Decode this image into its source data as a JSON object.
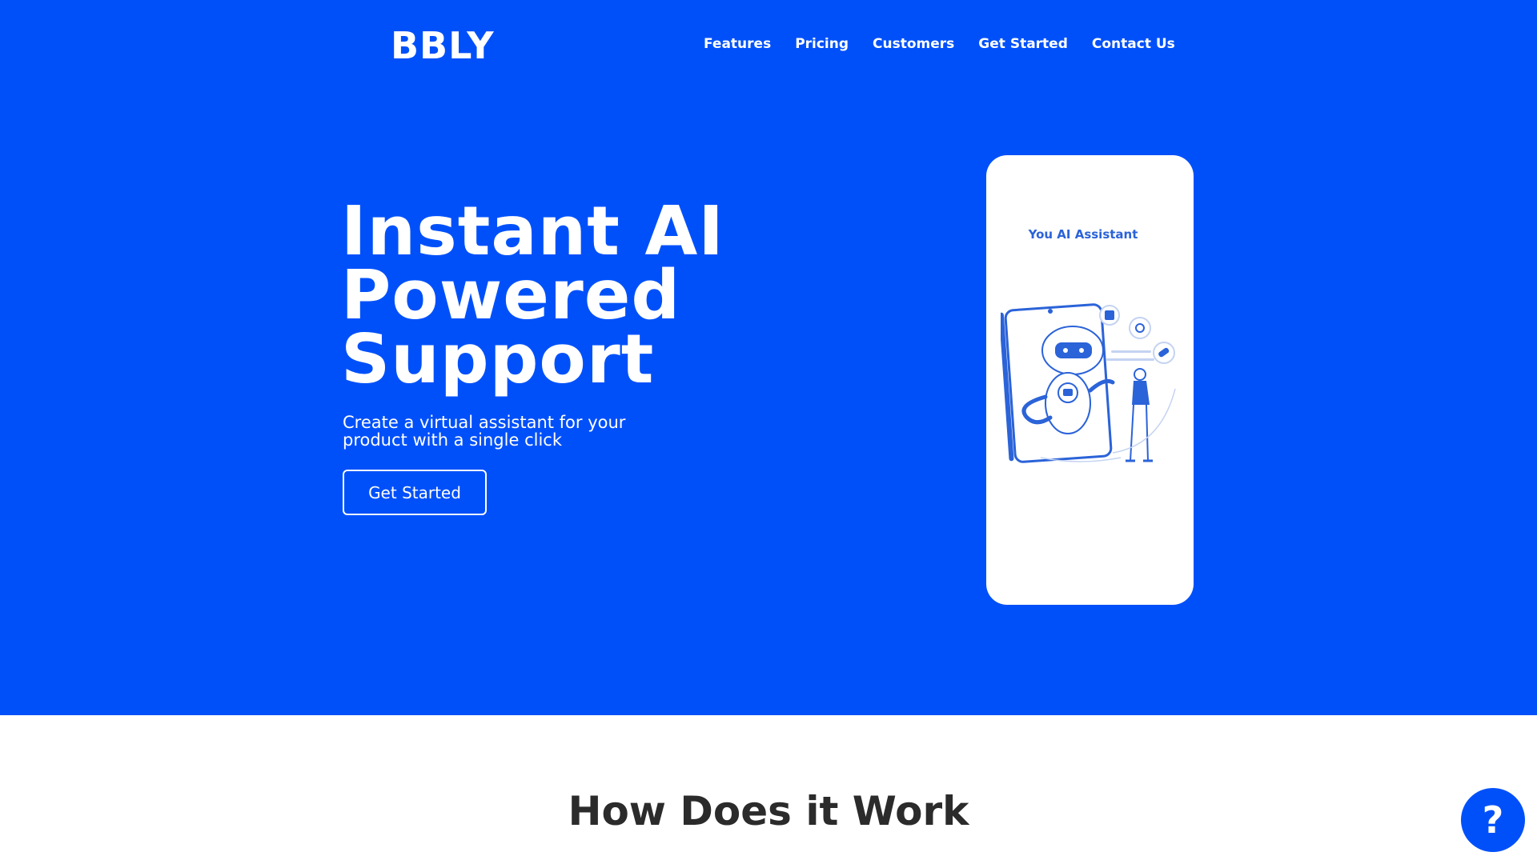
{
  "brand": {
    "logo_text": "BBLY",
    "accent_color": "#0050fa"
  },
  "nav": {
    "items": [
      {
        "label": "Features"
      },
      {
        "label": "Pricing"
      },
      {
        "label": "Customers"
      },
      {
        "label": "Get Started"
      },
      {
        "label": "Contact Us"
      }
    ]
  },
  "hero": {
    "headline_lines": [
      "Instant AI",
      "Powered",
      "Support"
    ],
    "subline": "Create a virtual assistant for your product with a single click",
    "cta_label": "Get Started",
    "phone": {
      "title": "You AI Assistant",
      "illustration": "robot-assistant-illustration"
    }
  },
  "section": {
    "title": "How Does it Work"
  },
  "help": {
    "icon": "question-icon",
    "label": "?"
  }
}
